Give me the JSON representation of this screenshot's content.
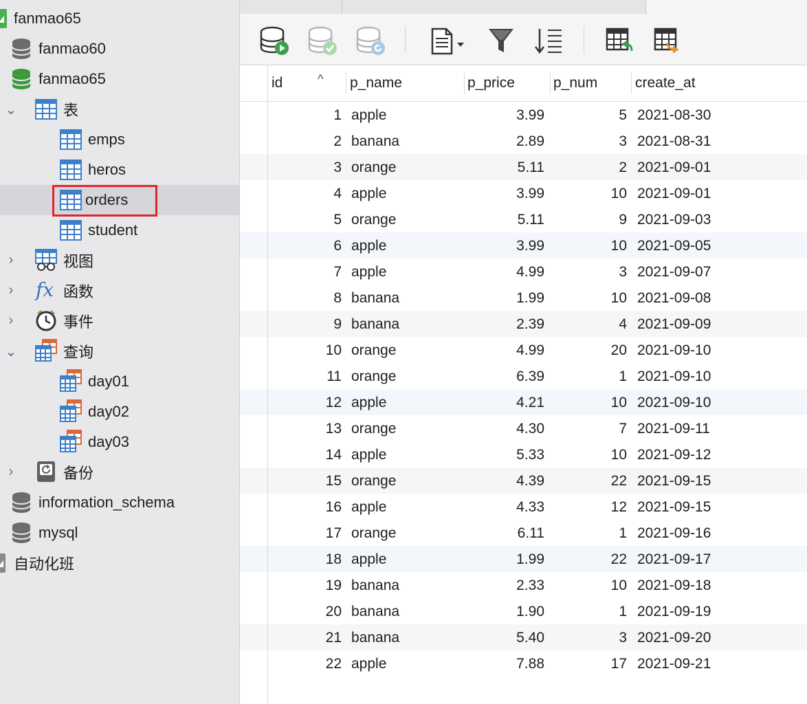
{
  "sidebar": {
    "items": [
      {
        "label": "fanmao65",
        "icon": "connection-icon"
      },
      {
        "label": "fanmao60",
        "icon": "database-gray-icon"
      },
      {
        "label": "fanmao65",
        "icon": "database-green-icon"
      },
      {
        "label": "表",
        "icon": "table-group-icon"
      },
      {
        "label": "emps",
        "icon": "table-icon"
      },
      {
        "label": "heros",
        "icon": "table-icon"
      },
      {
        "label": "orders",
        "icon": "table-icon"
      },
      {
        "label": "student",
        "icon": "table-icon"
      },
      {
        "label": "视图",
        "icon": "view-icon"
      },
      {
        "label": "函数",
        "icon": "function-icon"
      },
      {
        "label": "事件",
        "icon": "event-clock-icon"
      },
      {
        "label": "查询",
        "icon": "query-group-icon"
      },
      {
        "label": "day01",
        "icon": "query-icon"
      },
      {
        "label": "day02",
        "icon": "query-icon"
      },
      {
        "label": "day03",
        "icon": "query-icon"
      },
      {
        "label": "备份",
        "icon": "backup-icon"
      },
      {
        "label": "information_schema",
        "icon": "database-gray-icon"
      },
      {
        "label": "mysql",
        "icon": "database-gray-icon"
      },
      {
        "label": "自动化班",
        "icon": "connection-icon"
      }
    ]
  },
  "toolbar": {
    "buttons": [
      "database-run-icon",
      "database-commit-icon",
      "database-refresh-icon",
      "document-menu-icon",
      "filter-icon",
      "sort-icon",
      "table-import-icon",
      "table-export-icon"
    ]
  },
  "colors": {
    "highlight": "#e0252a",
    "db_green": "#3a9a3a",
    "table_blue": "#3d7fc9",
    "query_orange": "#d9673a"
  },
  "grid": {
    "columns": [
      "id",
      "p_name",
      "p_price",
      "p_num",
      "create_at"
    ],
    "sort_indicator": "^",
    "rows": [
      [
        "1",
        "apple",
        "3.99",
        "5",
        "2021-08-30"
      ],
      [
        "2",
        "banana",
        "2.89",
        "3",
        "2021-08-31"
      ],
      [
        "3",
        "orange",
        "5.11",
        "2",
        "2021-09-01"
      ],
      [
        "4",
        "apple",
        "3.99",
        "10",
        "2021-09-01"
      ],
      [
        "5",
        "orange",
        "5.11",
        "9",
        "2021-09-03"
      ],
      [
        "6",
        "apple",
        "3.99",
        "10",
        "2021-09-05"
      ],
      [
        "7",
        "apple",
        "4.99",
        "3",
        "2021-09-07"
      ],
      [
        "8",
        "banana",
        "1.99",
        "10",
        "2021-09-08"
      ],
      [
        "9",
        "banana",
        "2.39",
        "4",
        "2021-09-09"
      ],
      [
        "10",
        "orange",
        "4.99",
        "20",
        "2021-09-10"
      ],
      [
        "11",
        "orange",
        "6.39",
        "1",
        "2021-09-10"
      ],
      [
        "12",
        "apple",
        "4.21",
        "10",
        "2021-09-10"
      ],
      [
        "13",
        "orange",
        "4.30",
        "7",
        "2021-09-11"
      ],
      [
        "14",
        "apple",
        "5.33",
        "10",
        "2021-09-12"
      ],
      [
        "15",
        "orange",
        "4.39",
        "22",
        "2021-09-15"
      ],
      [
        "16",
        "apple",
        "4.33",
        "12",
        "2021-09-15"
      ],
      [
        "17",
        "orange",
        "6.11",
        "1",
        "2021-09-16"
      ],
      [
        "18",
        "apple",
        "1.99",
        "22",
        "2021-09-17"
      ],
      [
        "19",
        "banana",
        "2.33",
        "10",
        "2021-09-18"
      ],
      [
        "20",
        "banana",
        "1.90",
        "1",
        "2021-09-19"
      ],
      [
        "21",
        "banana",
        "5.40",
        "3",
        "2021-09-20"
      ],
      [
        "22",
        "apple",
        "7.88",
        "17",
        "2021-09-21"
      ]
    ]
  }
}
